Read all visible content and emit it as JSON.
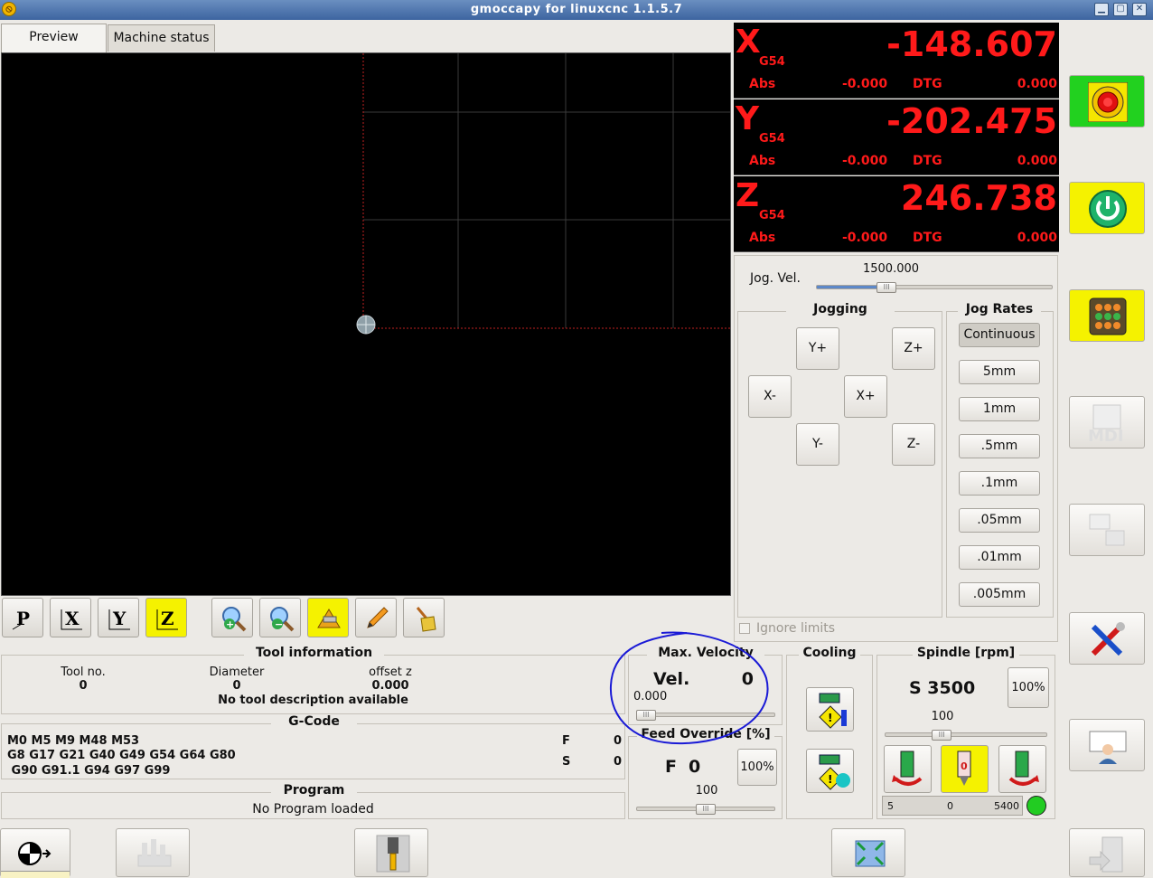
{
  "window": {
    "title": "gmoccapy for linuxcnc   1.1.5.7"
  },
  "tabs": [
    {
      "label": "Preview",
      "active": true
    },
    {
      "label": "Machine status",
      "active": false
    }
  ],
  "dro": [
    {
      "axis": "X",
      "system": "G54",
      "value": "-148.607",
      "abs_label": "Abs",
      "abs_value": "-0.000",
      "dtg_label": "DTG",
      "dtg_value": "0.000"
    },
    {
      "axis": "Y",
      "system": "G54",
      "value": "-202.475",
      "abs_label": "Abs",
      "abs_value": "-0.000",
      "dtg_label": "DTG",
      "dtg_value": "0.000"
    },
    {
      "axis": "Z",
      "system": "G54",
      "value": "246.738",
      "abs_label": "Abs",
      "abs_value": "-0.000",
      "dtg_label": "DTG",
      "dtg_value": "0.000"
    }
  ],
  "jog": {
    "vel_label": "Jog. Vel.",
    "vel_value": "1500.000",
    "vel_fraction": 0.28,
    "jogging_title": "Jogging",
    "buttons": {
      "y_plus": "Y+",
      "y_minus": "Y-",
      "x_plus": "X+",
      "x_minus": "X-",
      "z_plus": "Z+",
      "z_minus": "Z-"
    },
    "rates_title": "Jog Rates",
    "rates": [
      "Continuous",
      "5mm",
      "1mm",
      ".5mm",
      ".1mm",
      ".05mm",
      ".01mm",
      ".005mm"
    ],
    "ignore_limits": "Ignore limits"
  },
  "tool_info": {
    "title": "Tool information",
    "tool_no_label": "Tool no.",
    "tool_no": "0",
    "diameter_label": "Diameter",
    "diameter": "0",
    "offset_label": "offset z",
    "offset": "0.000",
    "description": "No tool description available"
  },
  "gcode": {
    "title": "G-Code",
    "line1": "M0 M5 M9 M48 M53",
    "line2": "G8 G17 G21 G40 G49 G54 G64 G80",
    "line3": " G90 G91.1 G94 G97 G99",
    "f_label": "F",
    "f_value": "0",
    "s_label": "S",
    "s_value": "0"
  },
  "program": {
    "title": "Program",
    "status": "No Program loaded"
  },
  "max_velocity": {
    "title": "Max. Velocity",
    "label": "Vel.",
    "value": "0",
    "slider_value": "0.000",
    "slider_fraction": 0.0
  },
  "feed_override": {
    "title": "Feed Override [%]",
    "label": "F",
    "value": "0",
    "reset": "100%",
    "slider_value": "100",
    "slider_fraction": 0.5
  },
  "cooling": {
    "title": "Cooling"
  },
  "spindle": {
    "title": "Spindle [rpm]",
    "speed": "S 3500",
    "reset": "100%",
    "override_value": "100",
    "override_fraction": 0.33,
    "bar_min": "5",
    "bar_value": "0",
    "bar_max": "5400",
    "status_color": "#22cc22"
  },
  "colors": {
    "dro_red": "#ff1a1a",
    "accent_yellow": "#f5f200",
    "estop_green": "#22d11f",
    "annotation_blue": "#1a1ad6"
  },
  "icons": [
    "e-stop-icon",
    "power-icon",
    "auto-mode-icon",
    "mdi-icon",
    "settings-icon",
    "tool-edit-icon",
    "user-tabs-icon",
    "exit-icon"
  ]
}
